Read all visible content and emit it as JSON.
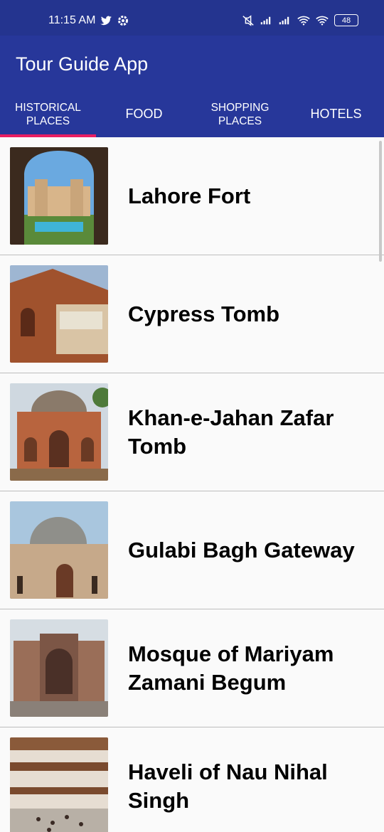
{
  "status_bar": {
    "time": "11:15 AM",
    "battery": "48",
    "icons": [
      "twitter-icon",
      "gear-icon",
      "mute-icon",
      "signal-icon",
      "signal-icon",
      "wifi-icon",
      "wifi-icon",
      "battery-icon"
    ]
  },
  "app_bar": {
    "title": "Tour Guide App"
  },
  "tabs": [
    {
      "label": "HISTORICAL PLACES"
    },
    {
      "label": "FOOD"
    },
    {
      "label": "SHOPPING PLACES"
    },
    {
      "label": "HOTELS"
    }
  ],
  "list": [
    {
      "title": "Lahore Fort"
    },
    {
      "title": "Cypress Tomb"
    },
    {
      "title": "Khan-e-Jahan Zafar Tomb"
    },
    {
      "title": "Gulabi Bagh Gateway"
    },
    {
      "title": "Mosque of Mariyam Zamani Begum"
    },
    {
      "title": "Haveli of Nau Nihal Singh"
    }
  ],
  "colors": {
    "primary": "#27379a",
    "status": "#24348f",
    "indicator": "#e91e63"
  }
}
